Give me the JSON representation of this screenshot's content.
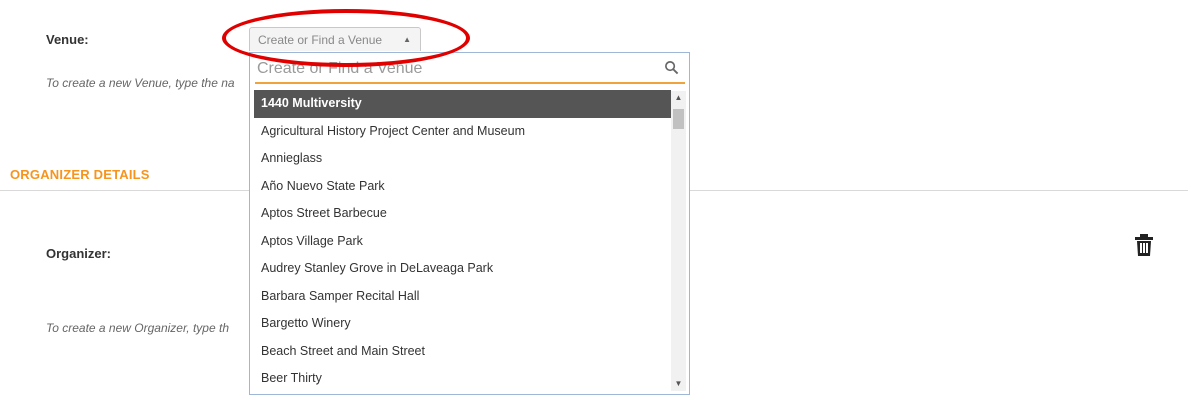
{
  "venue": {
    "label": "Venue:",
    "select_placeholder": "Create or Find a Venue",
    "hint": "To create a new Venue, type the na"
  },
  "organizer_section": {
    "title": "ORGANIZER DETAILS"
  },
  "organizer": {
    "label": "Organizer:",
    "hint": "To create a new Organizer, type th"
  },
  "dropdown": {
    "search_placeholder": "Create or Find a Venue",
    "options": [
      "1440 Multiversity",
      "Agricultural History Project Center and Museum",
      "Annieglass",
      "Año Nuevo State Park",
      "Aptos Street Barbecue",
      "Aptos Village Park",
      "Audrey Stanley Grove in DeLaveaga Park",
      "Barbara Samper Recital Hall",
      "Bargetto Winery",
      "Beach Street and Main Street",
      "Beer Thirty"
    ],
    "selected_index": 0
  },
  "icons": {
    "search": "search-icon",
    "trash": "trash-icon",
    "dropdown_arrow": "triangle-up-icon"
  },
  "colors": {
    "accent": "#f7941d",
    "highlight_ring": "#e00000",
    "selected_bg": "#555555",
    "dropdown_border": "#9fb7d6"
  }
}
